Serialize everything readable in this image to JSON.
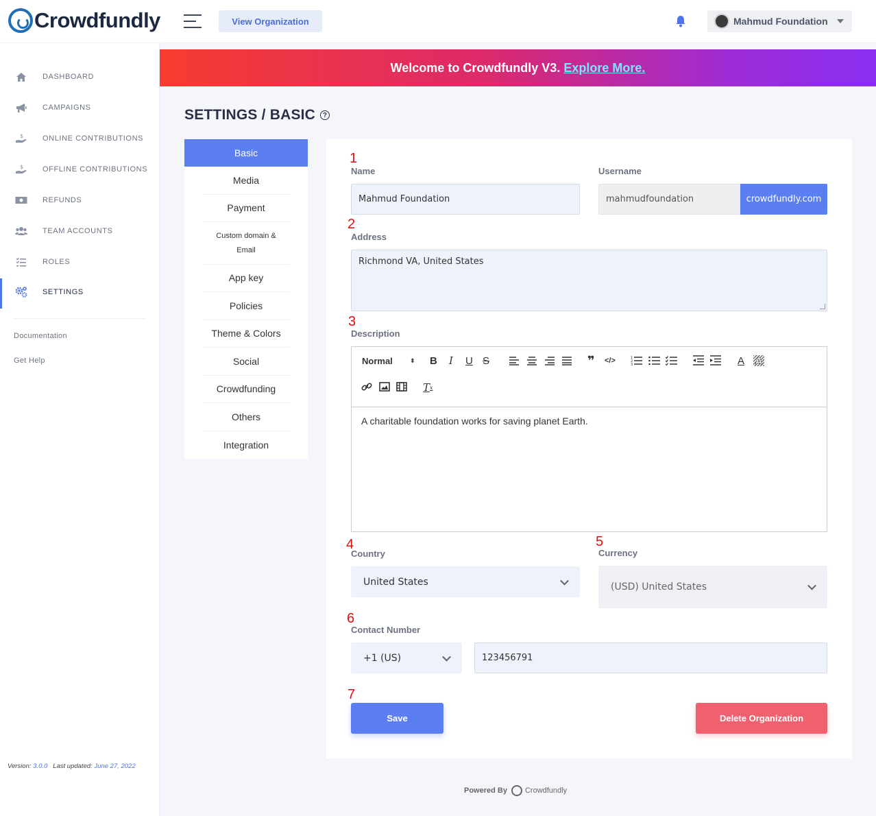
{
  "header": {
    "logo_text": "Crowdfundly",
    "view_org_label": "View Organization",
    "org_name": "Mahmud Foundation"
  },
  "sidebar": {
    "items": [
      {
        "label": "DASHBOARD",
        "icon": "home-icon"
      },
      {
        "label": "CAMPAIGNS",
        "icon": "megaphone-icon"
      },
      {
        "label": "ONLINE CONTRIBUTIONS",
        "icon": "donation-hand-icon"
      },
      {
        "label": "OFFLINE CONTRIBUTIONS",
        "icon": "donation-hand-icon"
      },
      {
        "label": "REFUNDS",
        "icon": "money-bill-icon"
      },
      {
        "label": "TEAM ACCOUNTS",
        "icon": "users-icon"
      },
      {
        "label": "ROLES",
        "icon": "list-check-icon"
      },
      {
        "label": "SETTINGS",
        "icon": "gears-icon",
        "active": true
      }
    ],
    "documentation": "Documentation",
    "get_help": "Get Help",
    "version_label": "Version:",
    "version": "3.0.0",
    "updated_label": "Last updated:",
    "updated": "June 27, 2022"
  },
  "banner": {
    "text": "Welcome to Crowdfundly V3.",
    "link": "Explore More."
  },
  "page": {
    "title": "SETTINGS / BASIC",
    "help_icon": "?"
  },
  "settings_menu": [
    "Basic",
    "Media",
    "Payment",
    "Custom domain &",
    "Email",
    "App key",
    "Policies",
    "Theme & Colors",
    "Social",
    "Crowdfunding",
    "Others",
    "Integration"
  ],
  "form": {
    "markers": [
      "1",
      "2",
      "3",
      "4",
      "5",
      "6",
      "7"
    ],
    "name_label": "Name",
    "name_value": "Mahmud Foundation",
    "username_label": "Username",
    "username_value": "mahmudfoundation",
    "username_suffix": "crowdfundly.com",
    "address_label": "Address",
    "address_value": "Richmond VA, United States",
    "description_label": "Description",
    "editor_format": "Normal",
    "description_value": "A charitable foundation works for saving planet Earth.",
    "country_label": "Country",
    "country_value": "United States",
    "currency_label": "Currency",
    "currency_value": "(USD) United States",
    "contact_label": "Contact Number",
    "dial_code": "+1 (US)",
    "phone_value": "123456791",
    "save_label": "Save",
    "delete_label": "Delete Organization"
  },
  "footer": {
    "powered_by": "Powered By",
    "brand": "Crowdfundly"
  },
  "colors": {
    "accent": "#5b7ff0",
    "danger": "#f0616f",
    "marker": "#e01010"
  }
}
